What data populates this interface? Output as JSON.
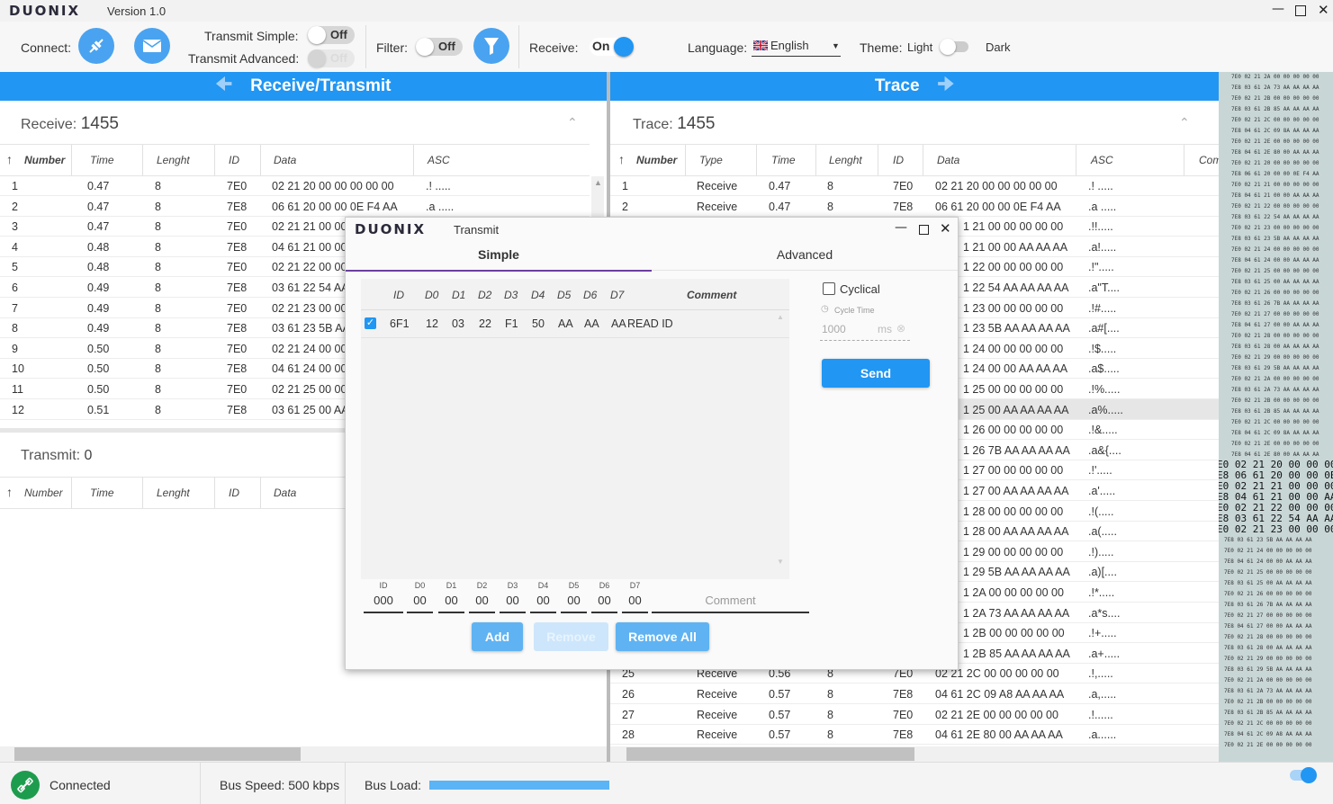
{
  "app": {
    "logo": "DUONIX",
    "version": "Version 1.0"
  },
  "toolbar": {
    "connect_label": "Connect:",
    "transmit_simple_label": "Transmit Simple:",
    "transmit_simple_state": "Off",
    "transmit_advanced_label": "Transmit Advanced:",
    "transmit_advanced_state": "Off",
    "filter_label": "Filter:",
    "filter_state": "Off",
    "receive_label": "Receive:",
    "receive_state": "On",
    "language_label": "Language:",
    "language_value": "English",
    "theme_label": "Theme:",
    "theme_light": "Light",
    "theme_dark": "Dark",
    "accent": "#2196f3"
  },
  "rx_panel": {
    "header": "Receive/Transmit",
    "receive_label": "Receive:",
    "receive_count": "1455",
    "columns": [
      "Number",
      "Time",
      "Lenght",
      "ID",
      "Data",
      "ASC"
    ],
    "rows": [
      [
        "1",
        "0.47",
        "8",
        "7E0",
        "02 21 20 00 00 00 00 00",
        ".! ....."
      ],
      [
        "2",
        "0.47",
        "8",
        "7E8",
        "06 61 20 00 00 0E F4 AA",
        ".a ....."
      ],
      [
        "3",
        "0.47",
        "8",
        "7E0",
        "02 21 21 00 00",
        ""
      ],
      [
        "4",
        "0.48",
        "8",
        "7E8",
        "04 61 21 00 00",
        ""
      ],
      [
        "5",
        "0.48",
        "8",
        "7E0",
        "02 21 22 00 00",
        ""
      ],
      [
        "6",
        "0.49",
        "8",
        "7E8",
        "03 61 22 54 AA",
        ""
      ],
      [
        "7",
        "0.49",
        "8",
        "7E0",
        "02 21 23 00 00",
        ""
      ],
      [
        "8",
        "0.49",
        "8",
        "7E8",
        "03 61 23 5B AA",
        ""
      ],
      [
        "9",
        "0.50",
        "8",
        "7E0",
        "02 21 24 00 00",
        ""
      ],
      [
        "10",
        "0.50",
        "8",
        "7E8",
        "04 61 24 00 00",
        ""
      ],
      [
        "11",
        "0.50",
        "8",
        "7E0",
        "02 21 25 00 00",
        ""
      ],
      [
        "12",
        "0.51",
        "8",
        "7E8",
        "03 61 25 00 AA",
        ""
      ]
    ],
    "transmit_label": "Transmit:",
    "transmit_count": "0",
    "tx_columns": [
      "Number",
      "Time",
      "Lenght",
      "ID",
      "Data"
    ]
  },
  "trace_panel": {
    "header": "Trace",
    "trace_label": "Trace:",
    "trace_count": "1455",
    "columns": [
      "Number",
      "Type",
      "Time",
      "Lenght",
      "ID",
      "Data",
      "ASC",
      "Com"
    ],
    "top_rows": [
      [
        "1",
        "Receive",
        "0.47",
        "8",
        "7E0",
        "02 21 20 00 00 00 00 00",
        ".! ....."
      ],
      [
        "2",
        "Receive",
        "0.47",
        "8",
        "7E8",
        "06 61 20 00 00 0E F4 AA",
        ".a ....."
      ]
    ],
    "partial_rows": [
      [
        "1 21 00 00 00 00 00",
        ".!!....."
      ],
      [
        "1 21 00 00 AA AA AA",
        ".a!....."
      ],
      [
        "1 22 00 00 00 00 00",
        ".!\"....."
      ],
      [
        "1 22 54 AA AA AA AA",
        ".a\"T...."
      ],
      [
        "1 23 00 00 00 00 00",
        ".!#....."
      ],
      [
        "1 23 5B AA AA AA AA",
        ".a#[...."
      ],
      [
        "1 24 00 00 00 00 00",
        ".!$....."
      ],
      [
        "1 24 00 00 AA AA AA",
        ".a$....."
      ],
      [
        "1 25 00 00 00 00 00",
        ".!%....."
      ],
      [
        "1 25 00 AA AA AA AA",
        ".a%....."
      ],
      [
        "1 26 00 00 00 00 00",
        ".!&....."
      ],
      [
        "1 26 7B AA AA AA AA",
        ".a&{...."
      ],
      [
        "1 27 00 00 00 00 00",
        ".!'....."
      ],
      [
        "1 27 00 AA AA AA AA",
        ".a'....."
      ],
      [
        "1 28 00 00 00 00 00",
        ".!(....."
      ],
      [
        "1 28 00 AA AA AA AA",
        ".a(....."
      ],
      [
        "1 29 00 00 00 00 00",
        ".!)....."
      ],
      [
        "1 29 5B AA AA AA AA",
        ".a)[...."
      ],
      [
        "1 2A 00 00 00 00 00",
        ".!*....."
      ],
      [
        "1 2A 73 AA AA AA AA",
        ".a*s...."
      ],
      [
        "1 2B 00 00 00 00 00",
        ".!+....."
      ],
      [
        "1 2B 85 AA AA AA AA",
        ".a+....."
      ]
    ],
    "bottom_rows": [
      [
        "25",
        "Receive",
        "0.56",
        "8",
        "7E0",
        "02 21 2C 00 00 00 00 00",
        ".!,....."
      ],
      [
        "26",
        "Receive",
        "0.57",
        "8",
        "7E8",
        "04 61 2C 09 A8 AA AA AA",
        ".a,....."
      ],
      [
        "27",
        "Receive",
        "0.57",
        "8",
        "7E0",
        "02 21 2E 00 00 00 00 00",
        ".!......"
      ],
      [
        "28",
        "Receive",
        "0.57",
        "8",
        "7E8",
        "04 61 2E 80 00 AA AA AA",
        ".a......"
      ]
    ]
  },
  "hexdump": {
    "small_top": [
      "7E0 02 21 2A 00 00 00 00 00",
      "7E8 03 61 2A 73 AA AA AA AA",
      "7E0 02 21 2B 00 00 00 00 00",
      "7E8 03 61 2B 85 AA AA AA AA",
      "7E0 02 21 2C 00 00 00 00 00",
      "7E8 04 61 2C 09 8A AA AA AA",
      "7E0 02 21 2E 00 00 00 00 00",
      "7E8 04 61 2E 80 00 AA AA AA",
      "7E0 02 21 20 00 00 00 00 00",
      "7E8 06 61 20 00 00 0E F4 AA",
      "7E0 02 21 21 00 00 00 00 00",
      "7E8 04 61 21 00 00 AA AA AA",
      "7E0 02 21 22 00 00 00 00 00",
      "7E8 03 61 22 54 AA AA AA AA",
      "7E0 02 21 23 00 00 00 00 00",
      "7E8 03 61 23 5B AA AA AA AA",
      "7E0 02 21 24 00 00 00 00 00",
      "7E8 04 61 24 00 00 AA AA AA",
      "7E0 02 21 25 00 00 00 00 00",
      "7E8 03 61 25 00 AA AA AA AA",
      "7E0 02 21 26 00 00 00 00 00",
      "7E8 03 61 26 7B AA AA AA AA",
      "7E0 02 21 27 00 00 00 00 00",
      "7E8 04 61 27 00 00 AA AA AA",
      "7E0 02 21 28 00 00 00 00 00",
      "7E8 03 61 28 00 AA AA AA AA",
      "7E0 02 21 29 00 00 00 00 00",
      "7E8 03 61 29 5B AA AA AA AA",
      "7E0 02 21 2A 00 00 00 00 00",
      "7E8 03 61 2A 73 AA AA AA AA",
      "7E0 02 21 2B 00 00 00 00 00",
      "7E8 03 61 2B 85 AA AA AA AA",
      "7E0 02 21 2C 00 00 00 00 00",
      "7E8 04 61 2C 09 8A AA AA AA",
      "7E0 02 21 2E 00 00 00 00 00",
      "7E8 04 61 2E 80 00 AA AA AA"
    ],
    "big_mid": [
      "E0 02 21 20 00 00 00 00 0",
      "E8 06 61 20 00 00 0E F4 A",
      "E0 02 21 21 00 00 00 00 0",
      "E8 04 61 21 00 00 AA AA A",
      "E0 02 21 22 00 00 00 00 0",
      "E8 03 61 22 54 AA AA AA A",
      "E0 02 21 23 00 00 00 00 0"
    ],
    "small_bottom": [
      "7E8 03 61 23 5B AA AA AA AA",
      "7E0 02 21 24 00 00 00 00 00",
      "7E8 04 61 24 00 00 AA AA AA",
      "7E0 02 21 25 00 00 00 00 00",
      "7E8 03 61 25 00 AA AA AA AA",
      "7E0 02 21 26 00 00 00 00 00",
      "7E8 03 61 26 7B AA AA AA AA",
      "7E0 02 21 27 00 00 00 00 00",
      "7E8 04 61 27 00 00 AA AA AA",
      "7E0 02 21 28 00 00 00 00 00",
      "7E8 03 61 28 00 AA AA AA AA",
      "7E0 02 21 29 00 00 00 00 00",
      "7E8 03 61 29 5B AA AA AA AA",
      "7E0 02 21 2A 00 00 00 00 00",
      "7E8 03 61 2A 73 AA AA AA AA",
      "7E0 02 21 2B 00 00 00 00 00",
      "7E8 03 61 2B 85 AA AA AA AA",
      "7E0 02 21 2C 00 00 00 00 00",
      "7E8 04 61 2C 09 A8 AA AA AA",
      "7E0 02 21 2E 00 00 00 00 00"
    ]
  },
  "dialog": {
    "logo": "DUONIX",
    "title": "Transmit",
    "tab_simple": "Simple",
    "tab_advanced": "Advanced",
    "columns": [
      "ID",
      "D0",
      "D1",
      "D2",
      "D3",
      "D4",
      "D5",
      "D6",
      "D7",
      "Comment"
    ],
    "row": [
      "6F1",
      "12",
      "03",
      "22",
      "F1",
      "50",
      "AA",
      "AA",
      "AA",
      "READ ID"
    ],
    "cyclical_label": "Cyclical",
    "cycle_time_label": "Cycle Time",
    "cycle_time_value": "1000",
    "cycle_unit": "ms",
    "send_label": "Send",
    "input_labels": [
      "ID",
      "D0",
      "D1",
      "D2",
      "D3",
      "D4",
      "D5",
      "D6",
      "D7"
    ],
    "input_values": [
      "000",
      "00",
      "00",
      "00",
      "00",
      "00",
      "00",
      "00",
      "00"
    ],
    "comment_placeholder": "Comment",
    "add_label": "Add",
    "remove_label": "Remove",
    "remove_all_label": "Remove All"
  },
  "status": {
    "connection": "Connected",
    "bus_speed": "Bus Speed: 500 kbps",
    "bus_load_label": "Bus Load:"
  }
}
